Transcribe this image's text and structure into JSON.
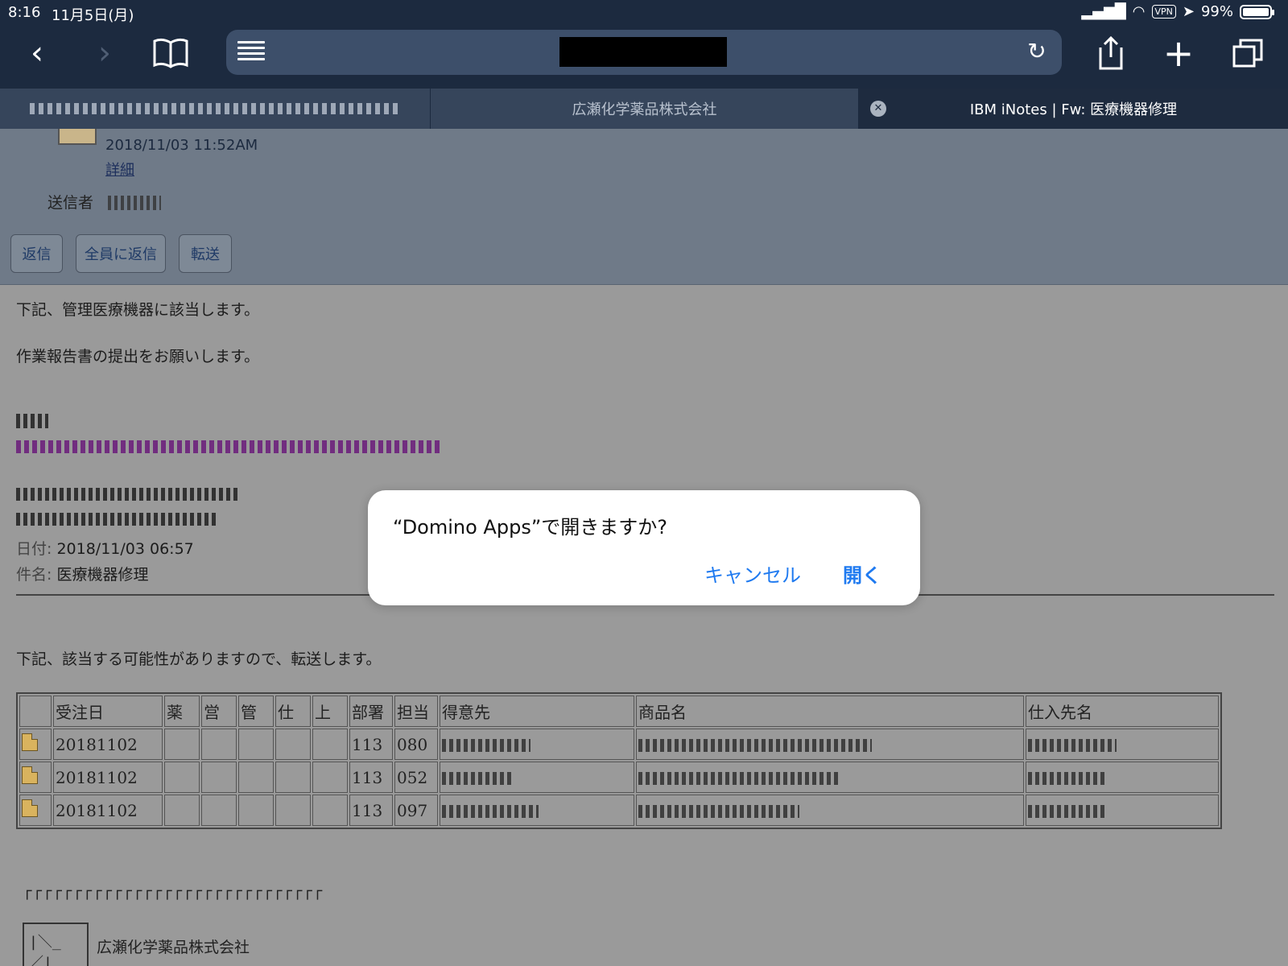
{
  "status_bar": {
    "time": "8:16",
    "date": "11月5日(月)",
    "vpn": "VPN",
    "battery": "99%",
    "battery_level": 0.99
  },
  "toolbar": {
    "back_icon": "chevron-left-icon",
    "forward_icon": "chevron-right-icon",
    "bookmarks_icon": "book-icon",
    "reader_icon": "reader-icon",
    "reload_icon": "reload-icon",
    "share_icon": "share-icon",
    "new_tab_icon": "plus-icon",
    "tabs_icon": "tabs-icon"
  },
  "tabs": [
    {
      "label": ""
    },
    {
      "label": "広瀬化学薬品株式会社"
    },
    {
      "label": "IBM iNotes | Fw: 医療機器修理"
    }
  ],
  "mail": {
    "timestamp": "2018/11/03 11:52AM",
    "detail_link": "詳細",
    "sender_label": "送信者",
    "buttons": {
      "reply": "返信",
      "reply_all": "全員に返信",
      "forward": "転送"
    }
  },
  "body": {
    "line1": "下記、管理医療機器に該当します。",
    "line2": "作業報告書の提出をお願いします。",
    "date_label": "日付:",
    "date_value": "2018/11/03 06:57",
    "subject_label": "件名:",
    "subject_value": "医療機器修理",
    "line3": "下記、該当する可能性がありますので、転送します。"
  },
  "table": {
    "headers": [
      "",
      "受注日",
      "薬",
      "営",
      "管",
      "仕",
      "上",
      "部署",
      "担当",
      "得意先",
      "商品名",
      "仕入先名"
    ],
    "rows": [
      {
        "date": "20181102",
        "dept": "113",
        "rep": "080"
      },
      {
        "date": "20181102",
        "dept": "113",
        "rep": "052"
      },
      {
        "date": "20181102",
        "dept": "113",
        "rep": "097"
      }
    ]
  },
  "signature": {
    "top_line": "┌┌┌┌┌┌┌┌┌┌┌┌┌┌┌┌┌┌┌┌┌┌┌┌┌┌┌┌┌┌",
    "box_line": "|＼_／|",
    "company": "広瀬化学薬品株式会社"
  },
  "dialog": {
    "message": "“Domino Apps”で開きますか?",
    "cancel": "キャンセル",
    "open": "開く"
  },
  "colors": {
    "toolbar_bg": "#1c2a3f",
    "link_blue": "#1f7af0",
    "overlay_gray": "#9a9a9a"
  }
}
